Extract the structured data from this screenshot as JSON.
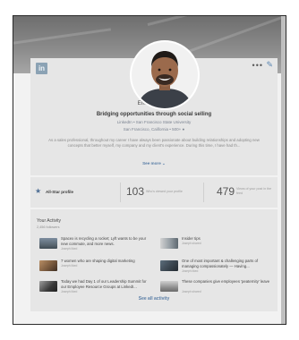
{
  "profile": {
    "name": "Emily Monroe",
    "headline": "Bridging opportunities through social selling",
    "education": "LinkedIn • San Francisco State University",
    "location": "San Francisco, California • 500+ ●",
    "summary": "As a sales professional, throughout my career I have always been passionate about building relationships and adopting new concepts that better myself, my company and my client's experience. During this time, I have had th...",
    "see_more": "See more ⌄",
    "more_icon": "more-icon",
    "edit_icon": "edit-icon"
  },
  "stats": {
    "badge": "All-Star profile",
    "views_count": "103",
    "views_label": "Who's viewed your profile",
    "post_count": "479",
    "post_label": "Views of your post in the feed"
  },
  "activity": {
    "title": "Your Activity",
    "followers": "2,456 followers",
    "items": [
      {
        "title": "Spacex is recycling a rocket; Lyft wants to be your new commute, and more news.",
        "type": "Joseph liked"
      },
      {
        "title": "Insider tips",
        "type": "Joseph shared"
      },
      {
        "title": "7 women who are shaping digital marketing",
        "type": "Joseph liked"
      },
      {
        "title": "One of most important & challenging parts of managing compassionately — Having...",
        "type": "Joseph liked"
      },
      {
        "title": "Today we had Day 1 of our Leadership Summit for our Employee Resource Groups at LinkedI...",
        "type": "Joseph liked"
      },
      {
        "title": "These companies give employees 'peaternity' leave",
        "type": "Joseph shared"
      }
    ],
    "see_all": "See all activity"
  },
  "colors": {
    "accent": "#5b7fa7",
    "card": "#e6e6e6",
    "banner": "#8a8a8a"
  }
}
